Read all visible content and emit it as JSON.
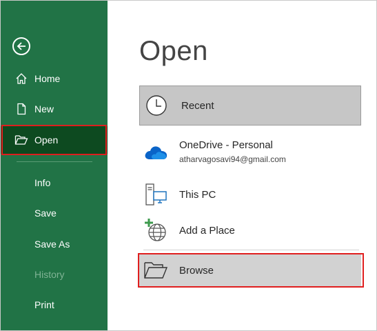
{
  "sidebar": {
    "back": {
      "icon": "back-arrow-icon"
    },
    "items": [
      {
        "label": "Home",
        "icon": "home-icon"
      },
      {
        "label": "New",
        "icon": "new-document-icon"
      },
      {
        "label": "Open",
        "icon": "folder-open-icon",
        "active": true
      },
      {
        "label": "Info"
      },
      {
        "label": "Save"
      },
      {
        "label": "Save As"
      },
      {
        "label": "History",
        "disabled": true
      },
      {
        "label": "Print"
      }
    ]
  },
  "main": {
    "title": "Open",
    "locations": {
      "recent": {
        "label": "Recent",
        "icon": "clock-icon"
      },
      "onedrive": {
        "label": "OneDrive - Personal",
        "account": "atharvagosavi94@gmail.com",
        "icon": "onedrive-cloud-icon"
      },
      "thispc": {
        "label": "This PC",
        "icon": "computer-icon"
      },
      "addplace": {
        "label": "Add a Place",
        "icon": "globe-add-icon"
      },
      "browse": {
        "label": "Browse",
        "icon": "folder-icon"
      }
    }
  },
  "colors": {
    "sidebar_bg": "#217346",
    "sidebar_active": "#0d4a20",
    "highlight_border": "#e01e1e",
    "recent_bg": "#c6c6c6",
    "browse_bg": "#d2d2d2"
  }
}
